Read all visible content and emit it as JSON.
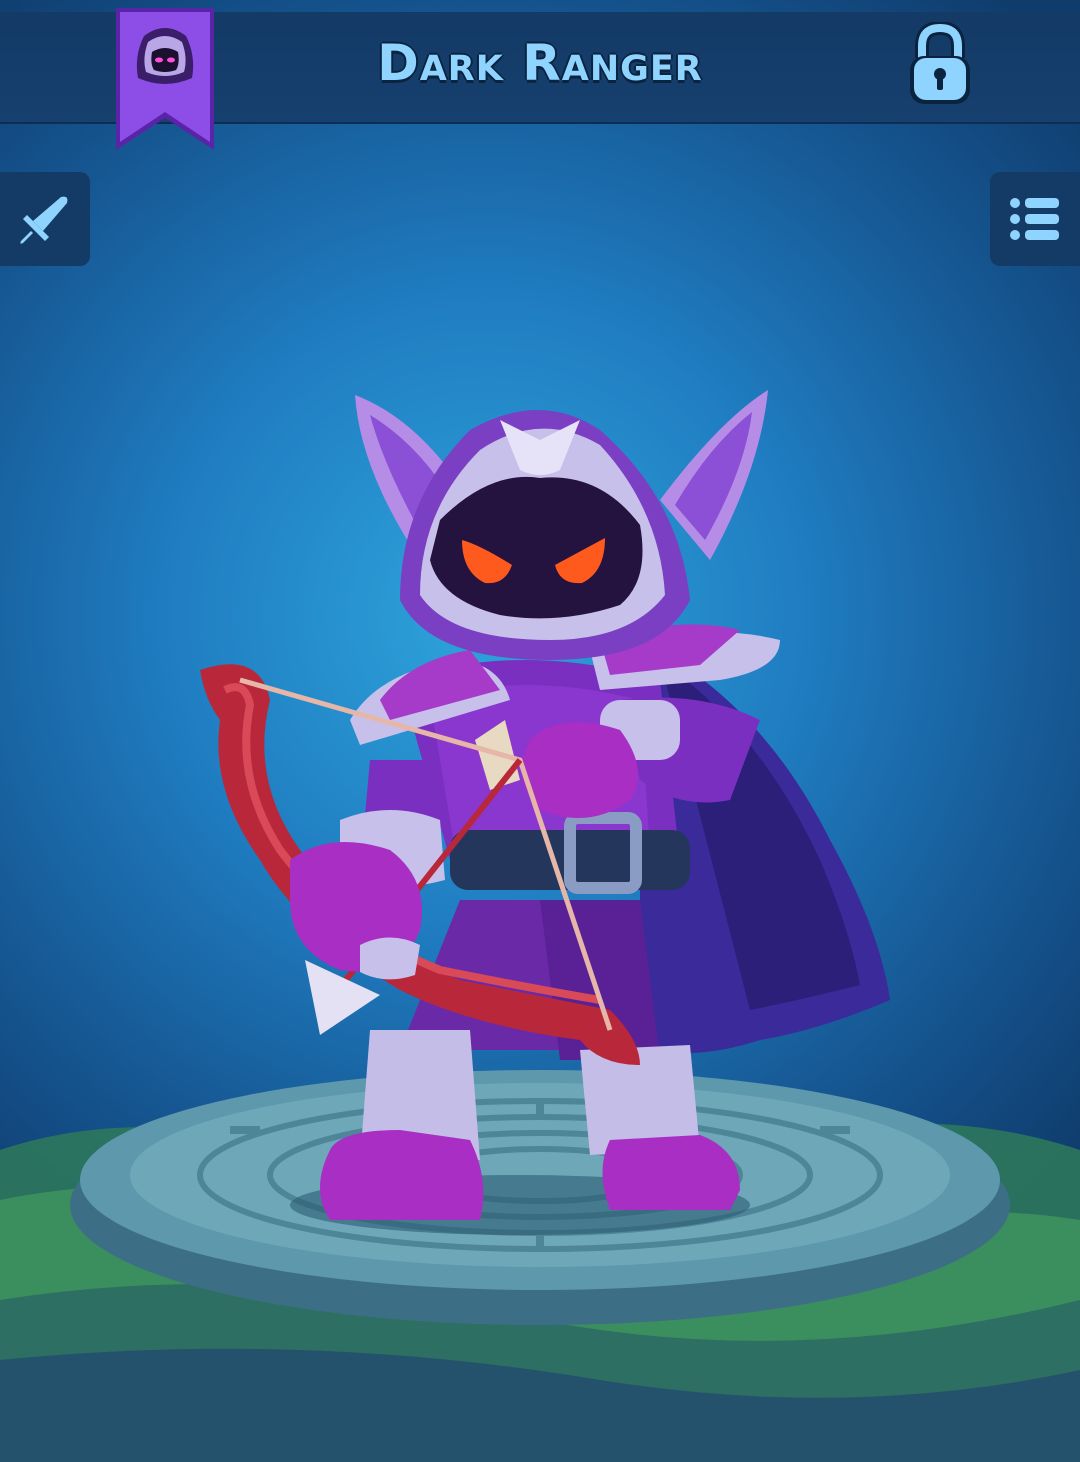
{
  "header": {
    "title": "Dark Ranger",
    "class_badge_icon": "hooded-figure-banner-icon",
    "lock_icon": "padlock-icon"
  },
  "side_buttons": {
    "left_icon": "sword-icon",
    "right_icon": "list-menu-icon"
  },
  "character": {
    "eye_color": "#ff5a1e",
    "hood_color": "#7a3fc2",
    "bow_color": "#b8283a"
  },
  "colors": {
    "title_text": "#8fd3ff",
    "bar_background": "#143a66",
    "banner_purple": "#8c4ee6"
  }
}
